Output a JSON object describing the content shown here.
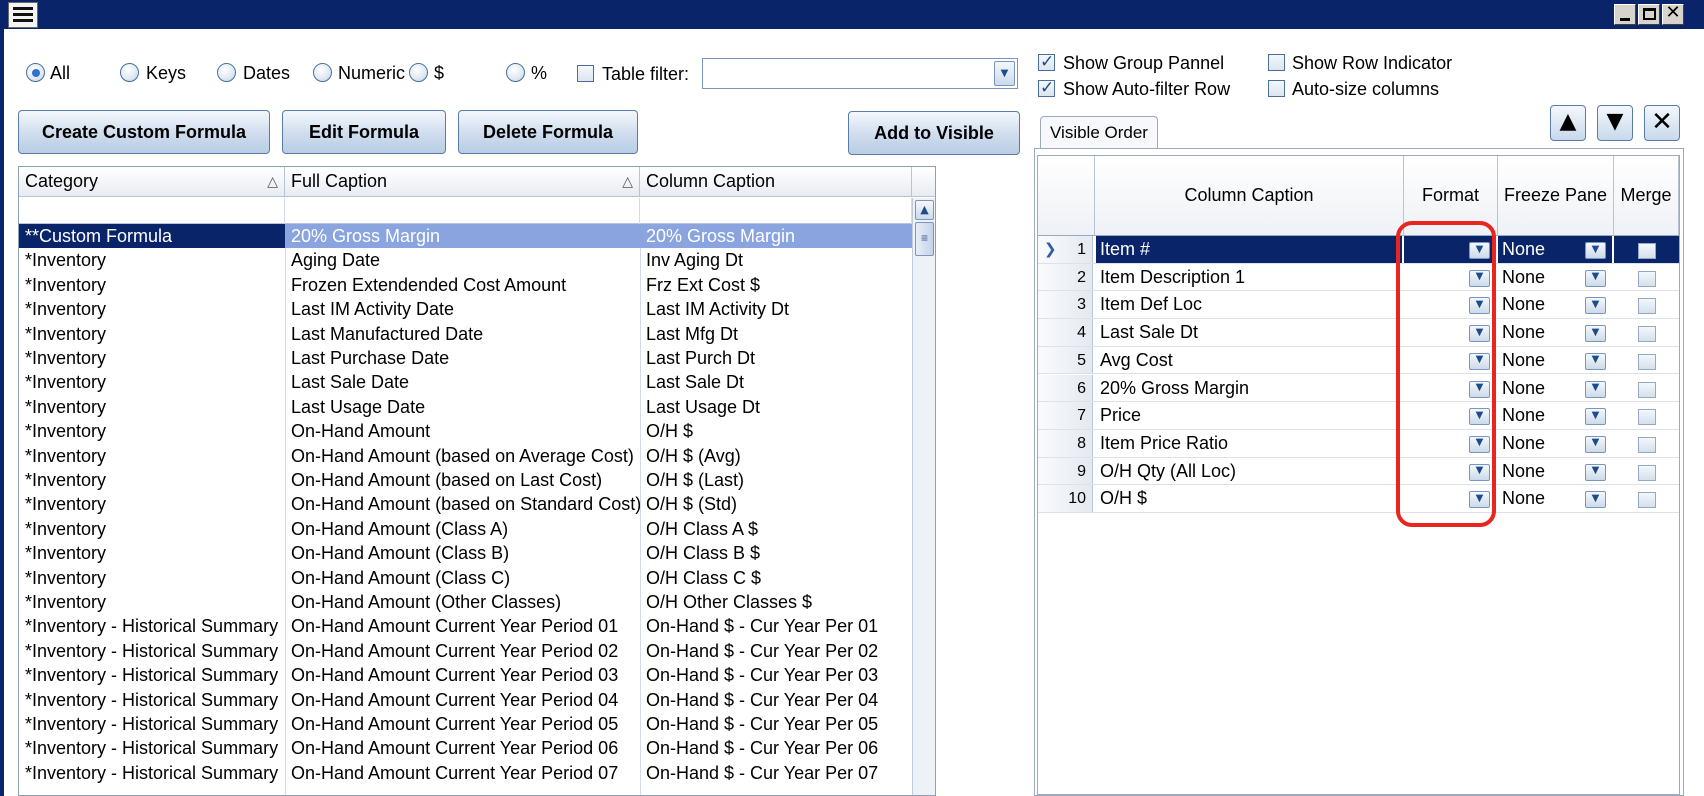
{
  "filter_radios": [
    {
      "label": "All",
      "selected": true
    },
    {
      "label": "Keys",
      "selected": false
    },
    {
      "label": "Dates",
      "selected": false
    },
    {
      "label": "Numeric",
      "selected": false
    },
    {
      "label": "$",
      "selected": false
    },
    {
      "label": "%",
      "selected": false
    }
  ],
  "table_filter": {
    "label": "Table filter:",
    "checked": false,
    "value": ""
  },
  "options": {
    "show_group_pannel": "Show Group Pannel",
    "show_auto_filter_row": "Show Auto-filter Row",
    "show_row_indicator": "Show Row Indicator",
    "auto_size_columns": "Auto-size columns"
  },
  "buttons": {
    "create_custom_formula": "Create Custom Formula",
    "edit_formula": "Edit Formula",
    "delete_formula": "Delete Formula",
    "add_to_visible": "Add to Visible"
  },
  "available_grid": {
    "columns": [
      "Category",
      "Full Caption",
      "Column Caption"
    ],
    "rows": [
      [
        "**Custom Formula",
        "20% Gross Margin",
        "20% Gross Margin"
      ],
      [
        "*Inventory",
        "Aging Date",
        "Inv Aging Dt"
      ],
      [
        "*Inventory",
        "Frozen Extendended Cost Amount",
        "Frz Ext Cost $"
      ],
      [
        "*Inventory",
        "Last IM Activity Date",
        "Last IM Activity Dt"
      ],
      [
        "*Inventory",
        "Last Manufactured Date",
        "Last Mfg Dt"
      ],
      [
        "*Inventory",
        "Last Purchase Date",
        "Last Purch Dt"
      ],
      [
        "*Inventory",
        "Last Sale Date",
        "Last Sale Dt"
      ],
      [
        "*Inventory",
        "Last Usage Date",
        "Last Usage Dt"
      ],
      [
        "*Inventory",
        "On-Hand Amount",
        "O/H $"
      ],
      [
        "*Inventory",
        "On-Hand Amount (based on Average Cost)",
        "O/H $ (Avg)"
      ],
      [
        "*Inventory",
        "On-Hand Amount (based on Last Cost)",
        "O/H $ (Last)"
      ],
      [
        "*Inventory",
        "On-Hand Amount (based on Standard Cost)",
        "O/H $ (Std)"
      ],
      [
        "*Inventory",
        "On-Hand Amount (Class A)",
        "O/H Class A $"
      ],
      [
        "*Inventory",
        "On-Hand Amount (Class B)",
        "O/H Class B $"
      ],
      [
        "*Inventory",
        "On-Hand Amount (Class C)",
        "O/H Class C $"
      ],
      [
        "*Inventory",
        "On-Hand Amount (Other Classes)",
        "O/H Other Classes $"
      ],
      [
        "*Inventory - Historical Summary",
        "On-Hand Amount Current Year Period 01",
        "On-Hand $ - Cur Year Per 01"
      ],
      [
        "*Inventory - Historical Summary",
        "On-Hand Amount Current Year Period 02",
        "On-Hand $ - Cur Year Per 02"
      ],
      [
        "*Inventory - Historical Summary",
        "On-Hand Amount Current Year Period 03",
        "On-Hand $ - Cur Year Per 03"
      ],
      [
        "*Inventory - Historical Summary",
        "On-Hand Amount Current Year Period 04",
        "On-Hand $ - Cur Year Per 04"
      ],
      [
        "*Inventory - Historical Summary",
        "On-Hand Amount Current Year Period 05",
        "On-Hand $ - Cur Year Per 05"
      ],
      [
        "*Inventory - Historical Summary",
        "On-Hand Amount Current Year Period 06",
        "On-Hand $ - Cur Year Per 06"
      ],
      [
        "*Inventory - Historical Summary",
        "On-Hand Amount Current Year Period 07",
        "On-Hand $ - Cur Year Per 07"
      ]
    ]
  },
  "visible_order": {
    "tab_label": "Visible Order",
    "columns": [
      "Column Caption",
      "Format",
      "Freeze Pane",
      "Merge"
    ],
    "rows": [
      {
        "n": "1",
        "caption": "Item #",
        "freeze": "None"
      },
      {
        "n": "2",
        "caption": "Item Description 1",
        "freeze": "None"
      },
      {
        "n": "3",
        "caption": "Item Def Loc",
        "freeze": "None"
      },
      {
        "n": "4",
        "caption": "Last Sale Dt",
        "freeze": "None"
      },
      {
        "n": "5",
        "caption": "Avg Cost",
        "freeze": "None"
      },
      {
        "n": "6",
        "caption": "20% Gross Margin",
        "freeze": "None"
      },
      {
        "n": "7",
        "caption": "Price",
        "freeze": "None"
      },
      {
        "n": "8",
        "caption": "Item Price Ratio",
        "freeze": "None"
      },
      {
        "n": "9",
        "caption": "O/H Qty (All Loc)",
        "freeze": "None"
      },
      {
        "n": "10",
        "caption": "O/H $",
        "freeze": "None"
      }
    ]
  },
  "colors": {
    "title_bar": "#0a246a",
    "highlight": "#e8261f",
    "selection": "#0a246a"
  }
}
